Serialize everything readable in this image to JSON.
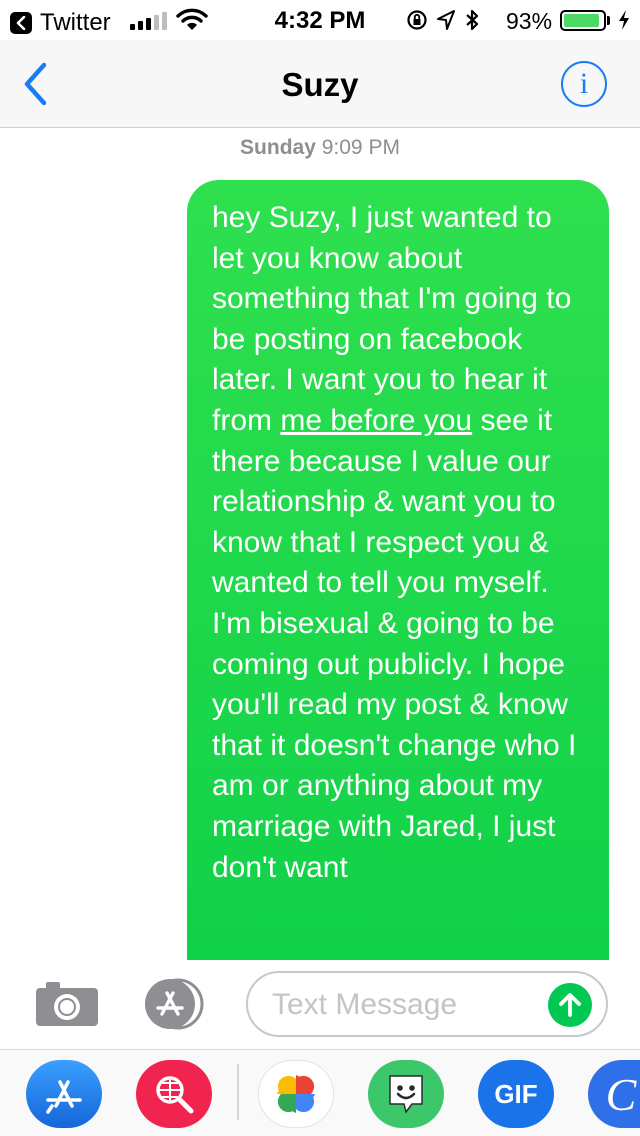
{
  "status_bar": {
    "back_app": "Twitter",
    "time": "4:32 PM",
    "battery_percent": "93%",
    "battery_level": 0.93
  },
  "nav": {
    "title": "Suzy",
    "back_icon": "chevron-left-icon",
    "info_icon": "info-icon",
    "info_glyph": "i"
  },
  "conversation": {
    "timestamp_day": "Sunday",
    "timestamp_time": "9:09 PM",
    "message": {
      "text_before": "hey Suzy, I just wanted to let you know about something that I'm going to be posting on facebook later. I want you to hear it from ",
      "text_underlined": "me before you",
      "text_after": " see it there because I value our relationship & want you to know that I respect you & wanted to tell you myself. I'm bisexual & going to be coming out publicly. I hope you'll read my post & know that it doesn't change who I am or anything about my marriage with Jared, I just don't want",
      "bubble_color": "#1fd94b"
    }
  },
  "input": {
    "placeholder": "Text Message",
    "value": "",
    "send_color": "#00c853"
  },
  "app_drawer": {
    "apps": [
      "app-store-icon",
      "web-images-search-icon",
      "photos-icon",
      "bitmoji-icon",
      "gif-icon",
      "app-partial-icon"
    ],
    "gif_label": "GIF",
    "partial_app_glyph": "C"
  }
}
